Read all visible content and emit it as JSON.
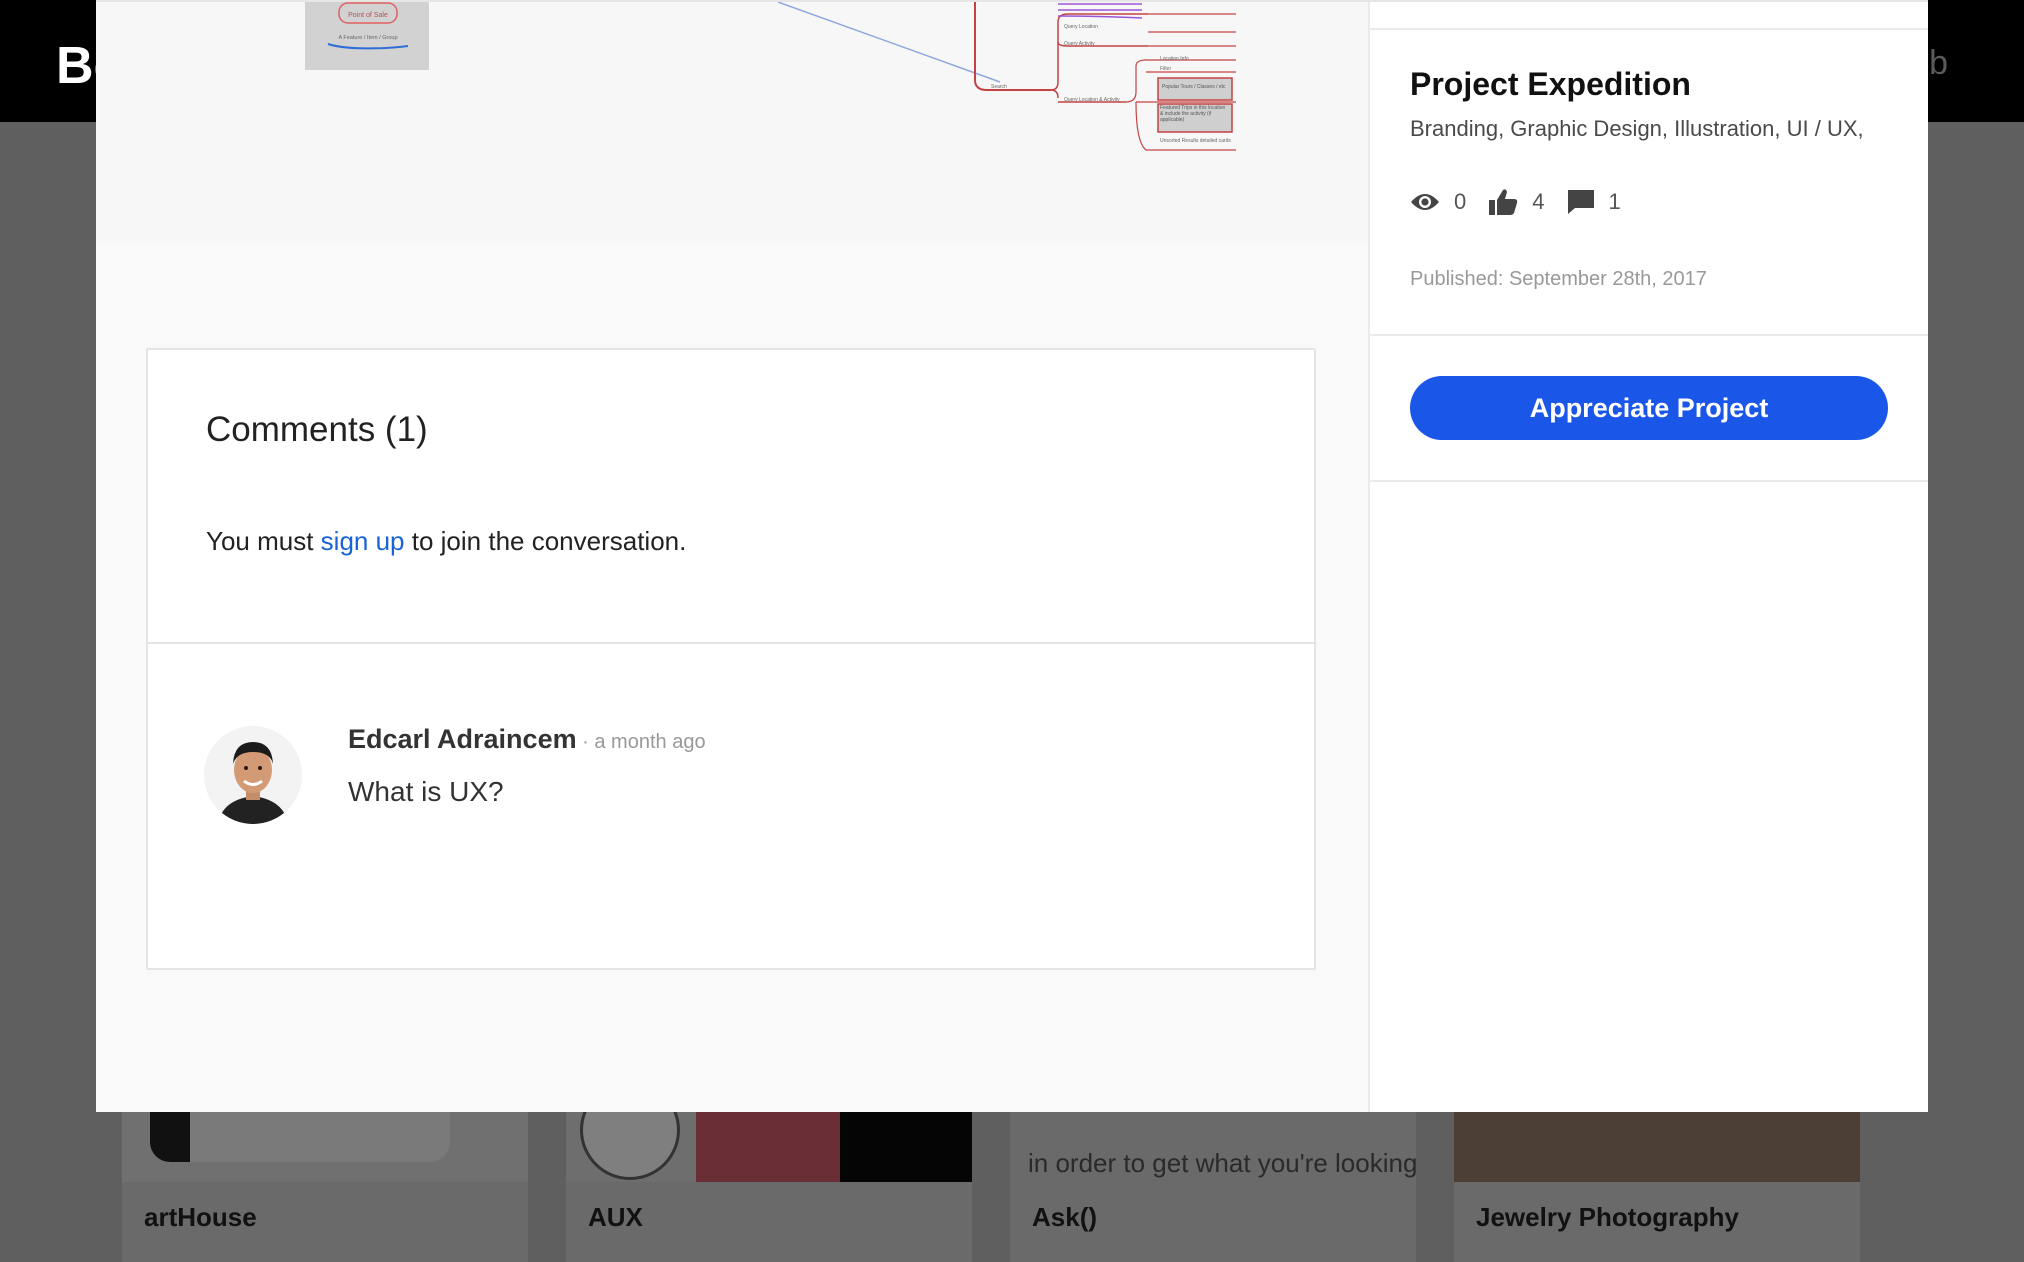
{
  "background": {
    "logo_text": "Be",
    "right_letter": "b",
    "cards": [
      {
        "title": "artHouse",
        "snippet": ""
      },
      {
        "title": "AUX",
        "snippet": ""
      },
      {
        "title": "Ask()",
        "snippet": "in order to get what you're looking"
      },
      {
        "title": "Jewelry Photography",
        "snippet": ""
      }
    ]
  },
  "project": {
    "title": "Project Expedition",
    "fields": "Branding, Graphic Design, Illustration, UI / UX,",
    "stats": {
      "views": "0",
      "appreciations": "4",
      "comments": "1"
    },
    "published": "Published: September 28th, 2017",
    "appreciate_label": "Appreciate Project"
  },
  "comments": {
    "title": "Comments (1)",
    "signup_prefix": "You must ",
    "signup_link": "sign up",
    "signup_suffix": " to join the conversation.",
    "items": [
      {
        "author": "Edcarl Adraincem",
        "time": "a month ago",
        "text": "What is UX?"
      }
    ]
  },
  "preview": {
    "labels": [
      "Point of Sale",
      "A Feature / Item / Group",
      "Search",
      "Query Location",
      "Query Activity",
      "Query Location & Activity",
      "Location Info",
      "Filter",
      "Popular Tours / Classes / etc",
      "Featured Trips in this location & include the activity (if applicable)",
      "Unsorted Results detailed cards"
    ]
  },
  "colors": {
    "accent": "#1a57e8",
    "link": "#1a62d8"
  }
}
